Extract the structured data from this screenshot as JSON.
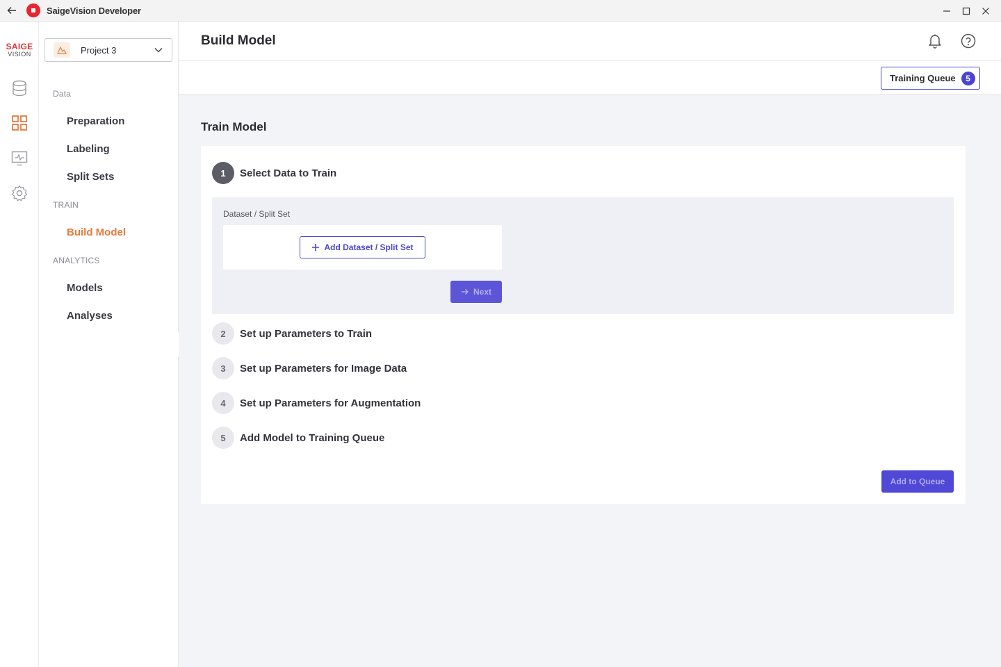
{
  "window": {
    "title": "SaigeVision Developer",
    "back_icon": "back-arrow-icon",
    "controls": [
      "minimize-icon",
      "maximize-icon",
      "close-icon"
    ]
  },
  "brand": {
    "top": "SAIGE",
    "bottom": "VISION",
    "color": "#e5343a"
  },
  "rail": {
    "items": [
      {
        "icon": "database-icon",
        "active": false
      },
      {
        "icon": "grid-icon",
        "active": true
      },
      {
        "icon": "monitor-icon",
        "active": false
      },
      {
        "icon": "gear-icon",
        "active": false
      }
    ]
  },
  "sidebar": {
    "project": {
      "name": "Project 3"
    },
    "sections": [
      {
        "label": "Data",
        "items": [
          "Preparation",
          "Labeling",
          "Split Sets"
        ]
      },
      {
        "label": "TRAIN",
        "items": [
          "Build Model"
        ]
      },
      {
        "label": "ANALYTICS",
        "items": [
          "Models",
          "Analyses"
        ]
      }
    ],
    "active_item": "Build Model",
    "accent_color": "#e57a3c"
  },
  "header": {
    "title": "Build Model",
    "icons": [
      "bell-icon",
      "help-icon"
    ],
    "training_queue": {
      "label": "Training Queue",
      "count": "5"
    }
  },
  "main": {
    "section_title": "Train Model",
    "steps": [
      {
        "num": "1",
        "title": "Select Data to Train",
        "active": true
      },
      {
        "num": "2",
        "title": "Set up Parameters to Train",
        "active": false
      },
      {
        "num": "3",
        "title": "Set up Parameters for Image Data",
        "active": false
      },
      {
        "num": "4",
        "title": "Set up Parameters for Augmentation",
        "active": false
      },
      {
        "num": "5",
        "title": "Add Model to Training Queue",
        "active": false
      }
    ],
    "step1": {
      "field_label": "Dataset / Split Set",
      "add_button": "Add Dataset / Split Set",
      "next_button": "Next"
    },
    "add_to_queue_button": "Add to Queue",
    "primary_color": "#4b46cf"
  }
}
